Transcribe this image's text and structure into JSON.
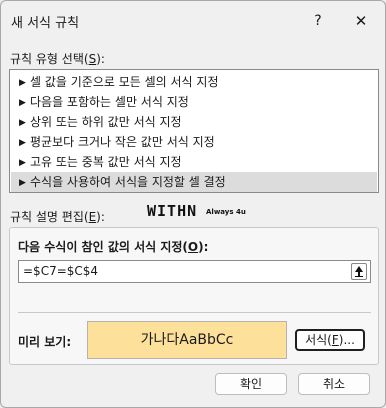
{
  "window": {
    "title": "새 서식 규칙",
    "help_label": "?",
    "close_label": "✕"
  },
  "rule_type": {
    "label": "규칙 유형 선택(",
    "accelerator": "S",
    "label_suffix": "):",
    "items": [
      {
        "label": "셀 값을 기준으로 모든 셀의 서식 지정",
        "selected": false
      },
      {
        "label": "다음을 포함하는 셀만 서식 지정",
        "selected": false
      },
      {
        "label": "상위 또는 하위 값만 서식 지정",
        "selected": false
      },
      {
        "label": "평균보다 크거나 작은 값만 서식 지정",
        "selected": false
      },
      {
        "label": "고유 또는 중복 값만 서식 지정",
        "selected": false
      },
      {
        "label": "수식을 사용하여 서식을 지정할 셀 결정",
        "selected": true
      }
    ],
    "arrow_glyph": "▶"
  },
  "edit": {
    "label": "규칙 설명 편집(",
    "accelerator": "E",
    "label_suffix": "):",
    "watermark": "WITHN",
    "watermark_sub": "Always 4u",
    "formula_label": "다음 수식이 참인 값의 서식 지정(",
    "formula_accelerator": "O",
    "formula_label_suffix": "):",
    "formula_value": "=$C7=$C$4",
    "preview_label": "미리 보기:",
    "preview_text": "가나다AaBbCc",
    "preview_fill": "#fde19b",
    "format_button_prefix": "서식(",
    "format_button_accelerator": "F",
    "format_button_suffix": ")..."
  },
  "footer": {
    "ok_label": "확인",
    "cancel_label": "취소"
  }
}
